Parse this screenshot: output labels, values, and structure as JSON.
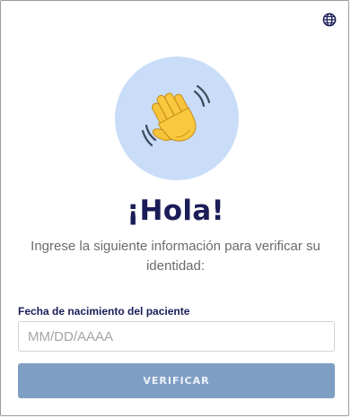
{
  "header": {
    "language_icon": "globe-icon"
  },
  "hero": {
    "icon": "waving-hand-icon",
    "background_color": "#c9ddf8"
  },
  "greeting": "¡Hola!",
  "subtitle": "Ingrese la siguiente información para verificar su identidad:",
  "form": {
    "dob_label": "Fecha de nacimiento del paciente",
    "dob_placeholder": "MM/DD/AAAA",
    "dob_value": "",
    "submit_label": "VERIFICAR",
    "submit_color": "#7f9ec3"
  },
  "colors": {
    "heading": "#1b1d58",
    "text": "#6b6b6b",
    "accent": "#1b1d58"
  }
}
